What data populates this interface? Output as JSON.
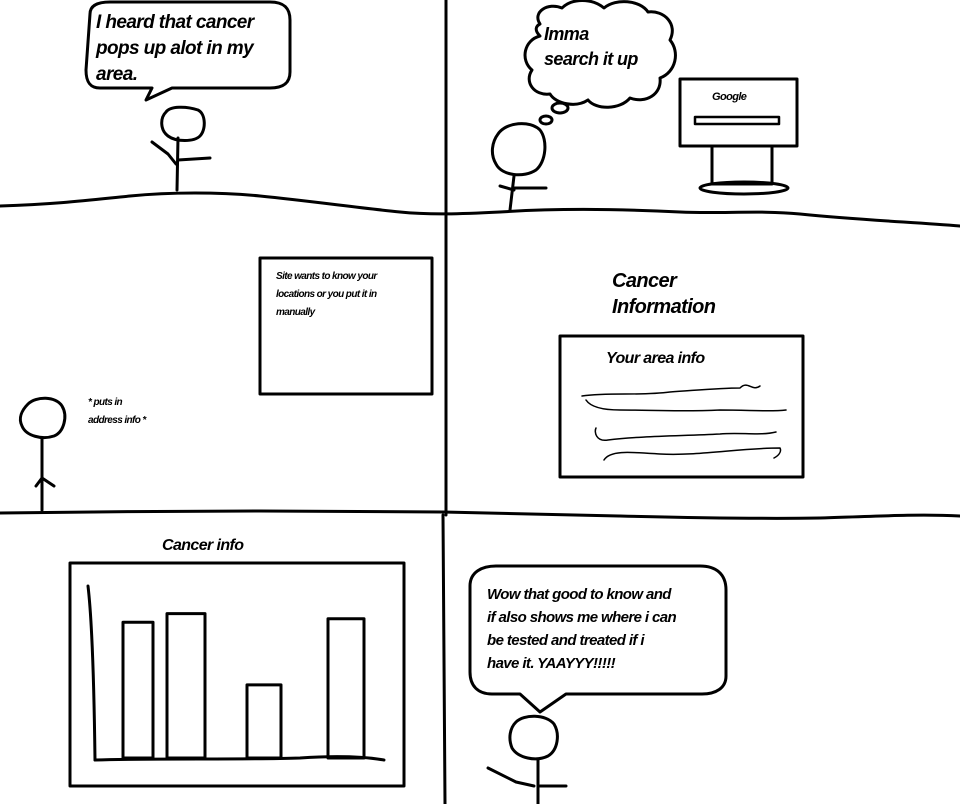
{
  "panels": {
    "panel1": {
      "speech": "I heard that cancer\npops up alot in my\narea."
    },
    "panel2": {
      "thought": "Imma\nsearch it up",
      "monitor_label": "Google"
    },
    "panel3": {
      "popup": "Site wants to know your\nlocations or you put it in\nmanually",
      "caption": "* puts in\naddress info *"
    },
    "panel4": {
      "title": "Cancer\nInformation",
      "box_title": "Your area info"
    },
    "panel5": {
      "title": "Cancer info"
    },
    "panel6": {
      "speech": "Wow that good to know and\nif also shows me where i can\nbe tested and treated if i\nhave it. YAAYYY!!!!!"
    }
  },
  "chart_data": {
    "type": "bar",
    "title": "Cancer info",
    "categories": [
      "",
      "",
      "",
      ""
    ],
    "values": [
      0.78,
      0.83,
      0.42,
      0.8
    ],
    "ylim": [
      0,
      1
    ],
    "grid": false,
    "note_axis_labels": "none printed"
  }
}
